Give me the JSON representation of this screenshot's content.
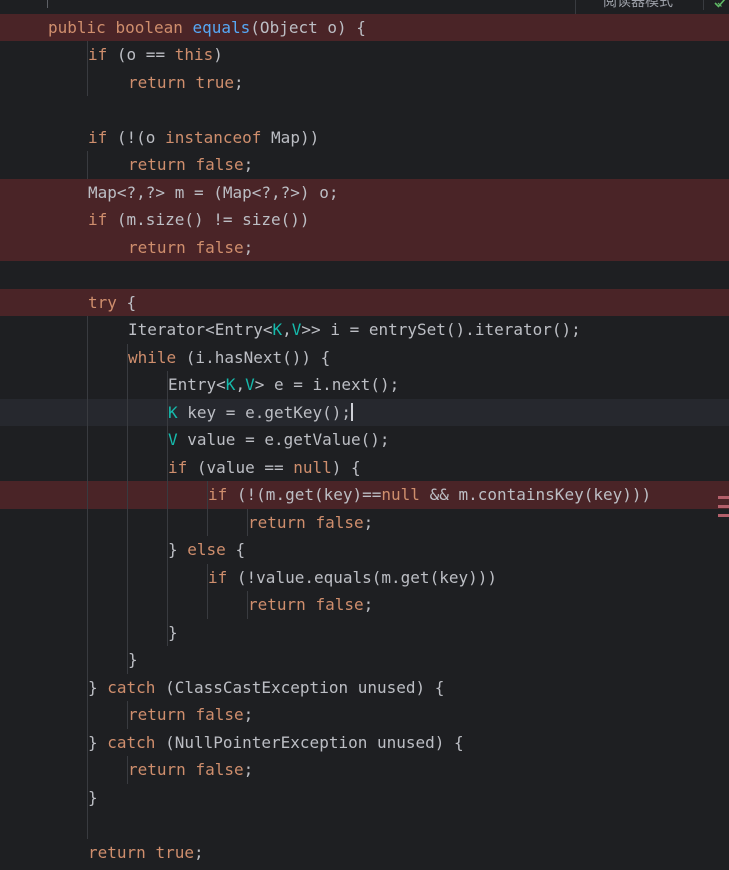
{
  "editor": {
    "reader_mode_label": "阅读器模式",
    "colors": {
      "background": "#1e1f22",
      "breakpoint_line": "#4a2427",
      "keyword": "#cf8e6d",
      "method": "#56a8f5",
      "type_param": "#16baac",
      "text": "#bcbec4"
    },
    "lines": [
      {
        "indent": 0,
        "bp": true,
        "tokens": [
          [
            "kw",
            "public "
          ],
          [
            "kw",
            "boolean "
          ],
          [
            "fn",
            "equals"
          ],
          [
            "",
            "(Object o) {"
          ]
        ]
      },
      {
        "indent": 1,
        "bp": false,
        "tokens": [
          [
            "kw",
            "if "
          ],
          [
            "",
            "(o == "
          ],
          [
            "kw",
            "this"
          ],
          [
            "",
            ")"
          ]
        ]
      },
      {
        "indent": 2,
        "bp": false,
        "tokens": [
          [
            "kw",
            "return "
          ],
          [
            "kw",
            "true"
          ],
          [
            "",
            ";"
          ]
        ]
      },
      {
        "indent": 0,
        "bp": false,
        "tokens": []
      },
      {
        "indent": 1,
        "bp": false,
        "tokens": [
          [
            "kw",
            "if "
          ],
          [
            "",
            "(!(o "
          ],
          [
            "kw",
            "instanceof "
          ],
          [
            "",
            "Map))"
          ]
        ]
      },
      {
        "indent": 2,
        "bp": false,
        "tokens": [
          [
            "kw",
            "return "
          ],
          [
            "kw",
            "false"
          ],
          [
            "",
            ";"
          ]
        ]
      },
      {
        "indent": 1,
        "bp": true,
        "tokens": [
          [
            "",
            "Map<?,?> m = (Map<?,?>) o;"
          ]
        ]
      },
      {
        "indent": 1,
        "bp": true,
        "tokens": [
          [
            "kw",
            "if "
          ],
          [
            "",
            "(m.size() != size())"
          ]
        ]
      },
      {
        "indent": 2,
        "bp": true,
        "tokens": [
          [
            "kw",
            "return "
          ],
          [
            "kw",
            "false"
          ],
          [
            "",
            ";"
          ]
        ]
      },
      {
        "indent": 0,
        "bp": false,
        "tokens": []
      },
      {
        "indent": 1,
        "bp": true,
        "tokens": [
          [
            "kw",
            "try "
          ],
          [
            "",
            "{"
          ]
        ]
      },
      {
        "indent": 2,
        "bp": false,
        "tokens": [
          [
            "",
            "Iterator<Entry<"
          ],
          [
            "tp",
            "K"
          ],
          [
            "",
            ","
          ],
          [
            "tp",
            "V"
          ],
          [
            "",
            ">> i = entrySet().iterator();"
          ]
        ]
      },
      {
        "indent": 2,
        "bp": false,
        "tokens": [
          [
            "kw",
            "while "
          ],
          [
            "",
            "(i.hasNext()) {"
          ]
        ]
      },
      {
        "indent": 3,
        "bp": false,
        "tokens": [
          [
            "",
            "Entry<"
          ],
          [
            "tp",
            "K"
          ],
          [
            "",
            ","
          ],
          [
            "tp",
            "V"
          ],
          [
            "",
            "> e = i.next();"
          ]
        ]
      },
      {
        "indent": 3,
        "bp": false,
        "caret": true,
        "tokens": [
          [
            "tp",
            "K "
          ],
          [
            "",
            "key = e.getKey();"
          ]
        ]
      },
      {
        "indent": 3,
        "bp": false,
        "tokens": [
          [
            "tp",
            "V "
          ],
          [
            "",
            "value = e.getValue();"
          ]
        ]
      },
      {
        "indent": 3,
        "bp": false,
        "tokens": [
          [
            "kw",
            "if "
          ],
          [
            "",
            "(value == "
          ],
          [
            "kw",
            "null"
          ],
          [
            "",
            ") {"
          ]
        ]
      },
      {
        "indent": 4,
        "bp": true,
        "tokens": [
          [
            "kw",
            "if "
          ],
          [
            "",
            "(!(m.get(key)=="
          ],
          [
            "kw",
            "null "
          ],
          [
            "",
            "&& m.containsKey(key)))"
          ]
        ]
      },
      {
        "indent": 5,
        "bp": false,
        "tokens": [
          [
            "kw",
            "return "
          ],
          [
            "kw",
            "false"
          ],
          [
            "",
            ";"
          ]
        ]
      },
      {
        "indent": 3,
        "bp": false,
        "tokens": [
          [
            "",
            "} "
          ],
          [
            "kw",
            "else "
          ],
          [
            "",
            "{"
          ]
        ]
      },
      {
        "indent": 4,
        "bp": false,
        "tokens": [
          [
            "kw",
            "if "
          ],
          [
            "",
            "(!value.equals(m.get(key)))"
          ]
        ]
      },
      {
        "indent": 5,
        "bp": false,
        "tokens": [
          [
            "kw",
            "return "
          ],
          [
            "kw",
            "false"
          ],
          [
            "",
            ";"
          ]
        ]
      },
      {
        "indent": 3,
        "bp": false,
        "tokens": [
          [
            "",
            "}"
          ]
        ]
      },
      {
        "indent": 2,
        "bp": false,
        "tokens": [
          [
            "",
            "}"
          ]
        ]
      },
      {
        "indent": 1,
        "bp": false,
        "tokens": [
          [
            "",
            "} "
          ],
          [
            "kw",
            "catch "
          ],
          [
            "",
            "(ClassCastException unused) {"
          ]
        ]
      },
      {
        "indent": 2,
        "bp": false,
        "tokens": [
          [
            "kw",
            "return "
          ],
          [
            "kw",
            "false"
          ],
          [
            "",
            ";"
          ]
        ]
      },
      {
        "indent": 1,
        "bp": false,
        "tokens": [
          [
            "",
            "} "
          ],
          [
            "kw",
            "catch "
          ],
          [
            "",
            "(NullPointerException unused) {"
          ]
        ]
      },
      {
        "indent": 2,
        "bp": false,
        "tokens": [
          [
            "kw",
            "return "
          ],
          [
            "kw",
            "false"
          ],
          [
            "",
            ";"
          ]
        ]
      },
      {
        "indent": 1,
        "bp": false,
        "tokens": [
          [
            "",
            "}"
          ]
        ]
      },
      {
        "indent": 0,
        "bp": false,
        "tokens": []
      },
      {
        "indent": 1,
        "bp": false,
        "tokens": [
          [
            "kw",
            "return "
          ],
          [
            "kw",
            "true"
          ],
          [
            "",
            ";"
          ]
        ]
      }
    ]
  }
}
